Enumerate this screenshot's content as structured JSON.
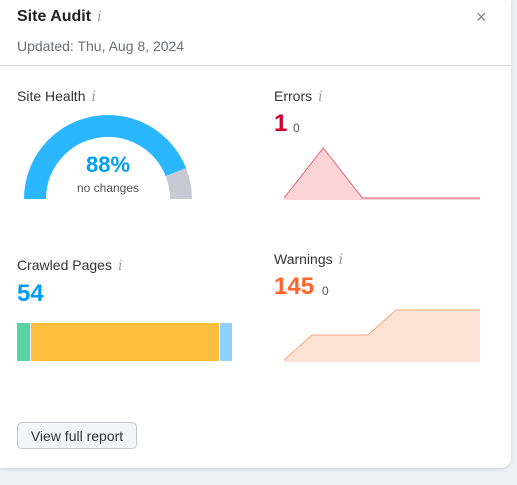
{
  "header": {
    "title": "Site Audit",
    "info": "i",
    "close": "×",
    "updated": "Updated: Thu, Aug 8, 2024"
  },
  "site_health": {
    "label": "Site Health",
    "info": "i",
    "value": "88%",
    "percent": 88,
    "subtext": "no changes",
    "color_main": "#2bb7ff",
    "color_rest": "#c8cad3"
  },
  "errors": {
    "label": "Errors",
    "info": "i",
    "value": "1",
    "delta": "0",
    "color": "#d1002f",
    "trend": [
      0,
      1,
      0,
      0,
      0,
      0
    ],
    "line_color": "#e5626f",
    "fill_color": "#fcd4d8"
  },
  "crawled_pages": {
    "label": "Crawled Pages",
    "info": "i",
    "value": "54",
    "color": "#009df5",
    "segments": [
      {
        "name": "healthy",
        "fraction": 0.06,
        "color": "#59d3a3"
      },
      {
        "name": "have-issues",
        "fraction": 0.87,
        "color": "#ffbe3d"
      },
      {
        "name": "redirected",
        "fraction": 0.06,
        "color": "#8ed0ff"
      }
    ]
  },
  "warnings": {
    "label": "Warnings",
    "info": "i",
    "value": "145",
    "delta": "0",
    "color": "#ff642d",
    "trend": [
      0,
      1,
      1,
      1,
      2,
      2,
      2,
      2
    ],
    "line_color": "#f5a878",
    "fill_color": "#fde3d3"
  },
  "footer": {
    "button": "View full report"
  }
}
